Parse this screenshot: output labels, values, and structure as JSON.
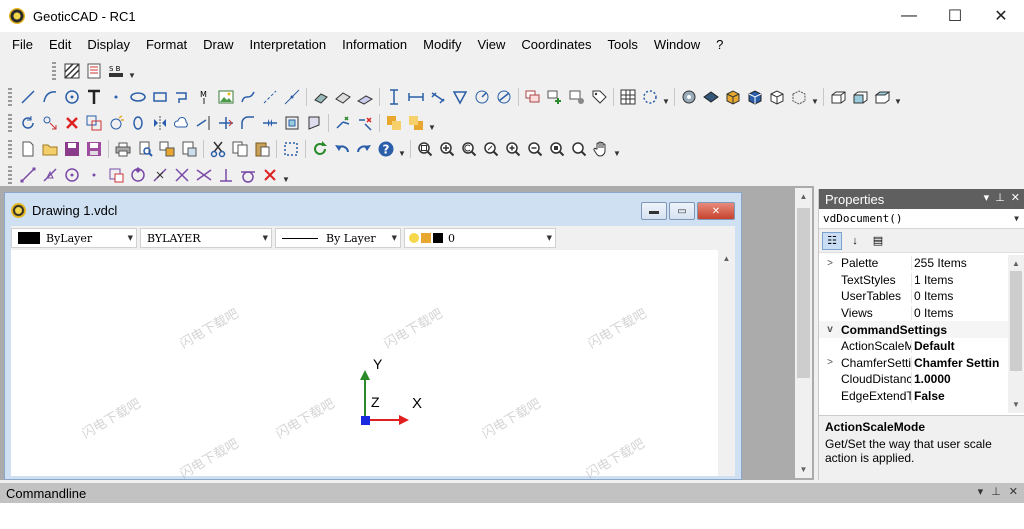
{
  "window": {
    "title": "GeoticCAD - RC1",
    "minimize": "—",
    "maximize": "☐",
    "close": "✕"
  },
  "menu": [
    "File",
    "Edit",
    "Display",
    "Format",
    "Draw",
    "Interpretation",
    "Information",
    "Modify",
    "View",
    "Coordinates",
    "Tools",
    "Window",
    "?"
  ],
  "document": {
    "title": "Drawing 1.vdcl",
    "layer_bar": {
      "color_label": "ByLayer",
      "layer_label": "BYLAYER",
      "linetype_label": "By Layer",
      "layer_state_value": "0"
    }
  },
  "axes": {
    "x": "X",
    "y": "Y",
    "z": "Z"
  },
  "watermark_text": "闪电下载吧",
  "properties": {
    "title": "Properties",
    "object": "vdDocument()",
    "rows": [
      {
        "type": "prop",
        "expand": ">",
        "key": "Palette",
        "value": "255 Items",
        "bold": false
      },
      {
        "type": "prop",
        "expand": "",
        "key": "TextStyles",
        "value": "1 Items",
        "bold": false
      },
      {
        "type": "prop",
        "expand": "",
        "key": "UserTables",
        "value": "0 Items",
        "bold": false
      },
      {
        "type": "prop",
        "expand": "",
        "key": "Views",
        "value": "0 Items",
        "bold": false
      },
      {
        "type": "cat",
        "expand": "v",
        "key": "CommandSettings",
        "value": "",
        "bold": true
      },
      {
        "type": "prop",
        "expand": "",
        "key": "ActionScaleM",
        "value": "Default",
        "bold": true
      },
      {
        "type": "prop",
        "expand": ">",
        "key": "ChamferSetti",
        "value": "Chamfer Settin",
        "bold": true
      },
      {
        "type": "prop",
        "expand": "",
        "key": "CloudDistanc",
        "value": "1.0000",
        "bold": true
      },
      {
        "type": "prop",
        "expand": "",
        "key": "EdgeExtendT",
        "value": "False",
        "bold": true
      }
    ],
    "desc_title": "ActionScaleMode",
    "desc_text": "Get/Set the way that user scale action is applied."
  },
  "commandline": {
    "title": "Commandline"
  },
  "colors": {
    "accent": "#2a5ea8",
    "panel_header": "#5f5f5f",
    "close_red": "#c7432d"
  }
}
